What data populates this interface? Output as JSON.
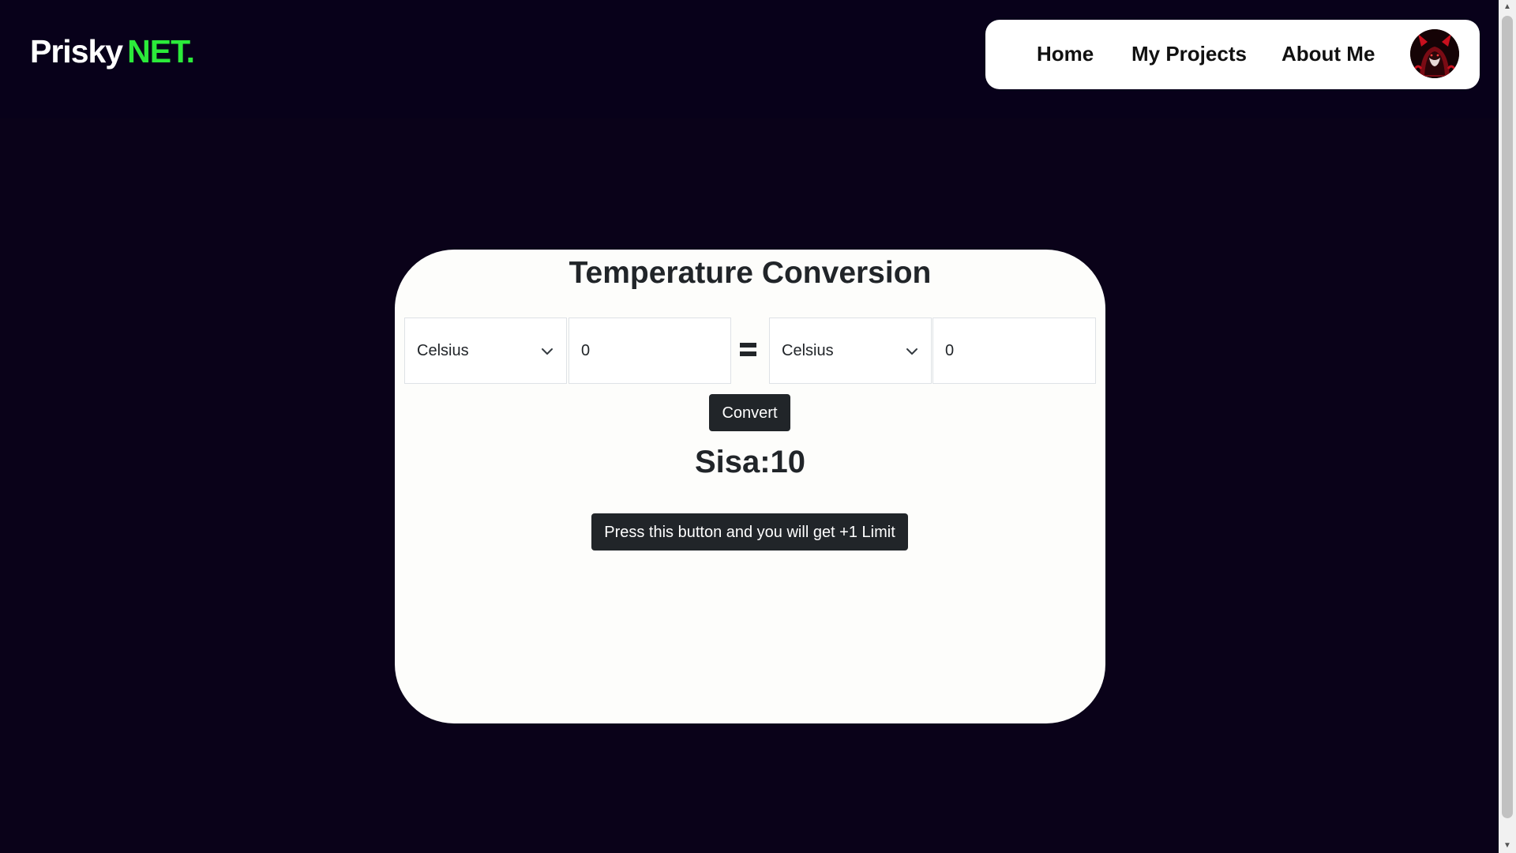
{
  "header": {
    "logo_main": "Prisky",
    "logo_accent": "NET."
  },
  "nav": {
    "items": [
      {
        "label": "Home"
      },
      {
        "label": "My Projects"
      },
      {
        "label": "About Me"
      }
    ],
    "avatar_icon": "devil-avatar-icon"
  },
  "converter": {
    "title": "Temperature Conversion",
    "from_unit": "Celsius",
    "from_value": "0",
    "equals_icon": "equals-icon",
    "to_unit": "Celsius",
    "to_value": "0",
    "convert_label": "Convert",
    "counter_text": "Sisa:10",
    "limit_button_label": "Press this button and you will get +1 Limit"
  },
  "colors": {
    "background": "#0a0219",
    "accent_green": "#2bea3a",
    "card": "#fdfdfb",
    "button_dark": "#212529"
  }
}
